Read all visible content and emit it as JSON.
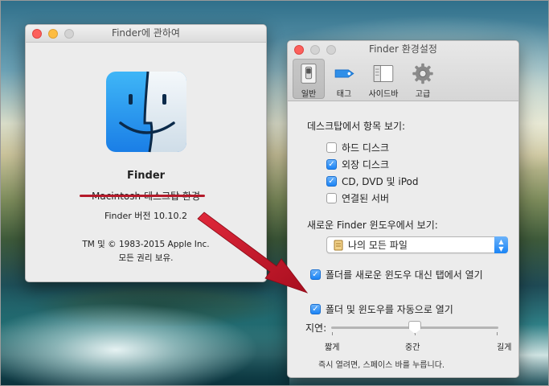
{
  "about_window": {
    "title": "Finder에 관하여",
    "app_name": "Finder",
    "description": "Macintosh 데스크탑 환경",
    "version": "Finder 버전 10.10.2",
    "copyright_line1": "TM 및 © 1983-2015 Apple Inc.",
    "copyright_line2": "모든 권리 보유."
  },
  "prefs_window": {
    "title": "Finder 환경설정",
    "tabs": [
      {
        "label": "일반",
        "icon": "general-switch-icon",
        "active": true
      },
      {
        "label": "태그",
        "icon": "tag-icon",
        "active": false
      },
      {
        "label": "사이드바",
        "icon": "sidebar-icon",
        "active": false
      },
      {
        "label": "고급",
        "icon": "gear-icon",
        "active": false
      }
    ],
    "desktop_section_label": "데스크탑에서 항목 보기:",
    "desktop_items": [
      {
        "label": "하드 디스크",
        "checked": false
      },
      {
        "label": "외장 디스크",
        "checked": true
      },
      {
        "label": "CD, DVD 및 iPod",
        "checked": true
      },
      {
        "label": "연결된 서버",
        "checked": false
      }
    ],
    "new_window_label": "새로운 Finder 윈도우에서 보기:",
    "new_window_selected": "나의 모든 파일",
    "open_folders_in_tabs": {
      "label": "폴더를 새로운 윈도우 대신 탭에서 열기",
      "checked": true
    },
    "spring_loaded": {
      "label": "폴더 및 윈도우를 자동으로 열기",
      "checked": true
    },
    "delay_label": "지연:",
    "delay_level": 0.5,
    "slider_short": "짧게",
    "slider_medium": "중간",
    "slider_long": "길게",
    "hint": "즉시 열려면, 스페이스 바를 누릅니다."
  },
  "colors": {
    "accent_blue": "#1b84f5",
    "annotation_red": "#c8102e",
    "close_red": "#fc605c",
    "minimize_yellow": "#fdbc40"
  }
}
